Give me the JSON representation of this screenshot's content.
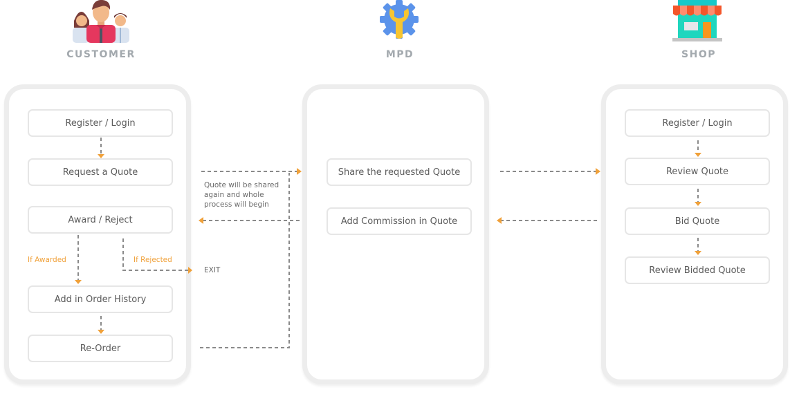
{
  "columns": {
    "customer": {
      "title": "CUSTOMER",
      "icon": "people-icon"
    },
    "mpd": {
      "title": "MPD",
      "icon": "gear-wrench-icon"
    },
    "shop": {
      "title": "SHOP",
      "icon": "storefront-icon"
    }
  },
  "customer_steps": [
    "Register / Login",
    "Request a Quote",
    "Award / Reject",
    "Add in Order History",
    "Re-Order"
  ],
  "mpd_steps": [
    "Share the requested Quote",
    "Add Commission in Quote"
  ],
  "shop_steps": [
    "Register / Login",
    "Review Quote",
    "Bid Quote",
    "Review Bidded Quote"
  ],
  "annotations": {
    "reorder_note": "Quote will be shared again and whole process will begin",
    "if_awarded": "If Awarded",
    "if_rejected": "If Rejected",
    "exit": "EXIT"
  },
  "colors": {
    "arrow_line": "#8a8a8a",
    "arrow_head": "#f0a13a",
    "title": "#a3a9ae",
    "lane_border": "#ededed"
  }
}
